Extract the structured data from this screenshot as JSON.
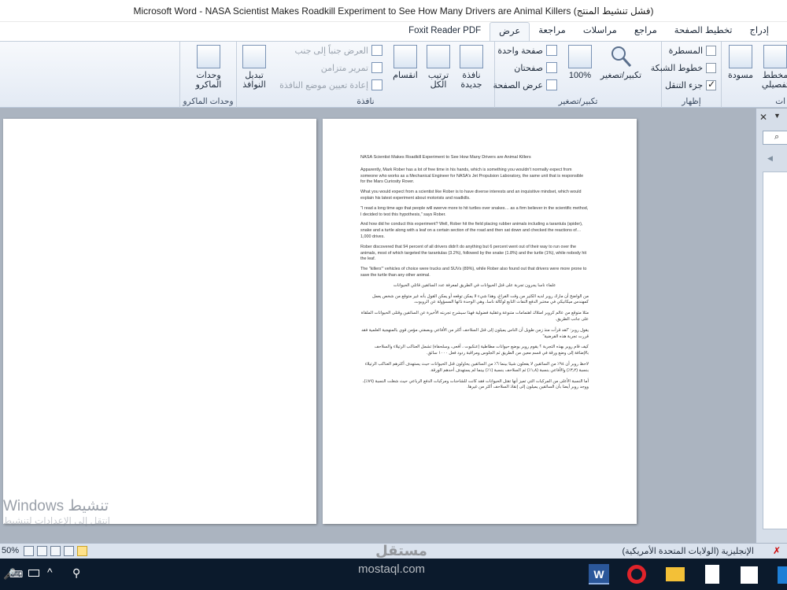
{
  "window": {
    "title": "Microsoft Word  -  NASA Scientist Makes Roadkill Experiment to See How Many Drivers are Animal Killers (فشل تنشيط المنتج)"
  },
  "tabs": [
    "إدراج",
    "تخطيط الصفحة",
    "مراجع",
    "مراسلات",
    "مراجعة",
    "عرض",
    "Foxit Reader PDF"
  ],
  "active_tab": "عرض",
  "ribbon": {
    "views": {
      "print_layout": "مخطط",
      "print_layout2": "تفصيلي",
      "draft": "مسودة",
      "partial": "ات"
    },
    "show": {
      "label": "إظهار",
      "ruler": "المسطرة",
      "gridlines": "خطوط الشبكة",
      "nav_pane": "جزء التنقل",
      "ruler_checked": false,
      "gridlines_checked": false,
      "nav_pane_checked": true
    },
    "zoom": {
      "label": "تكبير/تصغير",
      "zoom_btn": "تكبير/تصغير",
      "percent": "100%",
      "one_page": "صفحة واحدة",
      "two_pages": "صفحتان",
      "page_width": "عرض الصفحة"
    },
    "window": {
      "label": "نافذة",
      "new_window": "نافذة",
      "new_window2": "جديدة",
      "arrange_all": "ترتيب",
      "arrange_all2": "الكل",
      "split": "انقسام",
      "side_by_side": "العرض جنباً إلى جنب",
      "sync_scroll": "تمرير متزامن",
      "reset_pos": "إعادة تعيين موضع النافذة",
      "switch": "تبديل",
      "switch2": "النوافذ"
    },
    "macros": {
      "label": "وحدات الماكرو",
      "btn": "وحدات",
      "btn2": "الماكرو"
    }
  },
  "document": {
    "title": "NASA Scientist Makes Roadkill Experiment to See How Many Drivers are Animal Killers",
    "en_paragraphs": [
      "Apparently, Mark Rober has a lot of free time in his hands, which is something you wouldn't normally expect from someone who works as a Mechanical Engineer for NASA's Jet Propulsion Laboratory, the same unit that is responsible for the Mars Curiosity Rover.",
      "What you would expect from a scientist like Rober is to have diverse interests and an inquisitive mindset, which would explain his latest experiment about motorists and roadkills.",
      "\"I read a long time ago that people will swerve more to hit turtles over snakes… as a firm believer in the scientific method, I decided to test this hypothesis,\" says Rober.",
      "And how did he conduct this experiment? Well, Rober hit the field placing rubber animals including a tarantula (spider), snake and a turtle along with a leaf on a certain section of the road and then sat down and checked the reactions of…1,000 drives.",
      "Rober discovered that 94 percent of all drivers didn't do anything but 6 percent went out of their way to run over the animals, most of which targeted the tarantulas (3.2%), followed by the snake (1.8%) and the turtle (1%), while nobody hit the leaf.",
      "The \"killers'\" vehicles of choice were trucks and SUVs (89%), while Rober also found out that drivers were more prone to save the turtle than any other animal."
    ],
    "ar_heading": "علماء ناسا يجرون تجربة على قتل الحيوانات في الطريق لمعرفة عدد السائقين قاتلي الحيوانات",
    "ar_paragraphs": [
      "من الواضح أن مارك روبر لديه الكثير من وقت الفراغ، وهذا شيء لا يمكن توقعه أو يمكن القول بأنه غير متوقع من شخص يعمل كمهندس ميكانيكي في مختبر الدفع النفاث التابع لوكالة ناسا، وهي الوحدة ذاتها المسؤولة عن الروبوت.",
      "مثلا متوقع من عالم كروبر امتلاك اهتمامات متنوعة وعقلية فضولية فهذا سيشرح تجربته الأخيرة عن السائقين وقتلى الحيوانات الملقاة على جانب الطريق.",
      "يقول روبر: \"لقد قرأت منذ زمن طويل أن الناس يميلون إلى قتل السلاحف أكثر من الأفاعي وبصفتي مؤمن قوي بالمنهجية العلمية فقد قررت تجربة هذه الفرضية\"",
      "كيف قام روبر بهذه التجربة ؟ يقوم روبر بوضع حيوانات مطاطية (عنكبوت ، أفعى، وسلحفاة) تشمل العناكب الرتيلاء والسلاحف بالإضافة إلى وضع ورقة في قسم معين من الطريق ثم الجلوس ومراقبة ردود فعل ١٠٠٠ سائق.",
      "لاحظ روبر أن ٩٤٪ من السائقين لا يفعلون شيئا بينما ٦٪ من السائقين يحاولون قتل الحيوانات حيث يستهدف أكثرهم العناكب الرتيلاء بنسبة (٣٫٢٪) والأفاعي بنسبة (١٫٨٪) ثم السلاحف بنسبة (١٪) بينما لم يستهدف أحدهم الورقة.",
      "أما النسبة الأعلى من المركبات التي تميز أنها تقتل الحيوانات فقد كانت للشاحنات ومركبات الدفع الرباعي حيث شغلت النسبة (٨٩٪)، ووجد روبر أيضا بأن السائقين يميلون إلى إنقاذ السلاحف أكثر من غيرها."
    ]
  },
  "watermark": {
    "line1": "تنشيط Windows",
    "line2": "انتقل إلى الإعدادات لتنشيط"
  },
  "statusbar": {
    "zoom": "50%",
    "language": "الإنجليزية (الولايات المتحدة الأمريكية)"
  },
  "site_watermark": {
    "brand": "مستقل",
    "url": "mostaql.com"
  },
  "taskbar": {
    "word_label": "W"
  }
}
